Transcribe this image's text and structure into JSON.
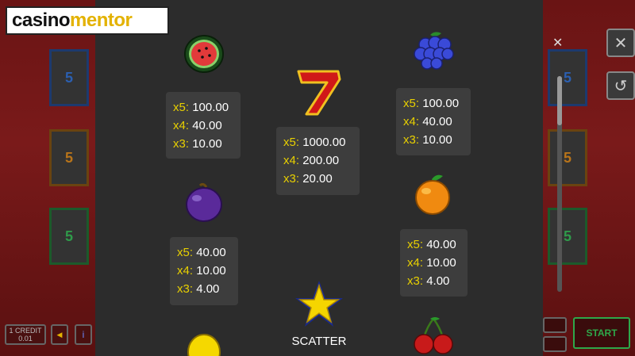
{
  "logo": {
    "part1": "casino",
    "part2": "mentor"
  },
  "reel_numbers": [
    "5",
    "5",
    "5",
    "5",
    "5",
    "5"
  ],
  "paytable": {
    "watermelon": {
      "icon": "watermelon-icon",
      "x5": "100.00",
      "x4": "40.00",
      "x3": "10.00"
    },
    "seven": {
      "icon": "seven-icon",
      "x5": "1000.00",
      "x4": "200.00",
      "x3": "20.00"
    },
    "grapes": {
      "icon": "grapes-icon",
      "x5": "100.00",
      "x4": "40.00",
      "x3": "10.00"
    },
    "plum": {
      "icon": "plum-icon",
      "x5": "40.00",
      "x4": "10.00",
      "x3": "4.00"
    },
    "orange": {
      "icon": "orange-icon",
      "x5": "40.00",
      "x4": "10.00",
      "x3": "4.00"
    },
    "labels": {
      "x5": "x5:",
      "x4": "x4:",
      "x3": "x3:"
    }
  },
  "scatter_label": "SCATTER",
  "controls": {
    "credit_line1": "1 CREDIT",
    "credit_line2": "0.01",
    "info": "i",
    "start": "START",
    "close": "✕"
  },
  "colors": {
    "accent_yellow": "#e8d000",
    "panel": "#2c2c2c",
    "start_green": "#2ea84a"
  }
}
